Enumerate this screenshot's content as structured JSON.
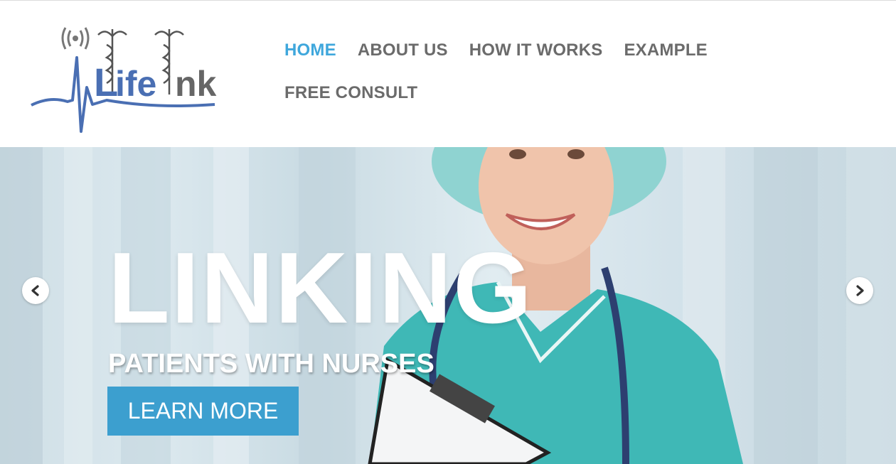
{
  "logo": {
    "text": "LifeInk",
    "colors": {
      "primary": "#4a6fb3",
      "secondary": "#666666"
    }
  },
  "nav": {
    "items": [
      {
        "label": "HOME",
        "active": true
      },
      {
        "label": "ABOUT US",
        "active": false
      },
      {
        "label": "HOW IT WORKS",
        "active": false
      },
      {
        "label": "EXAMPLE",
        "active": false
      },
      {
        "label": "FREE CONSULT",
        "active": false
      }
    ],
    "colors": {
      "active": "#3fa7dc",
      "default": "#6b6b6b"
    }
  },
  "hero": {
    "title": "LINKING",
    "subtitle": "PATIENTS WITH NURSES",
    "cta_label": "LEARN MORE",
    "cta_color": "#3c9fcf",
    "prev_icon": "chevron-left-icon",
    "next_icon": "chevron-right-icon"
  }
}
